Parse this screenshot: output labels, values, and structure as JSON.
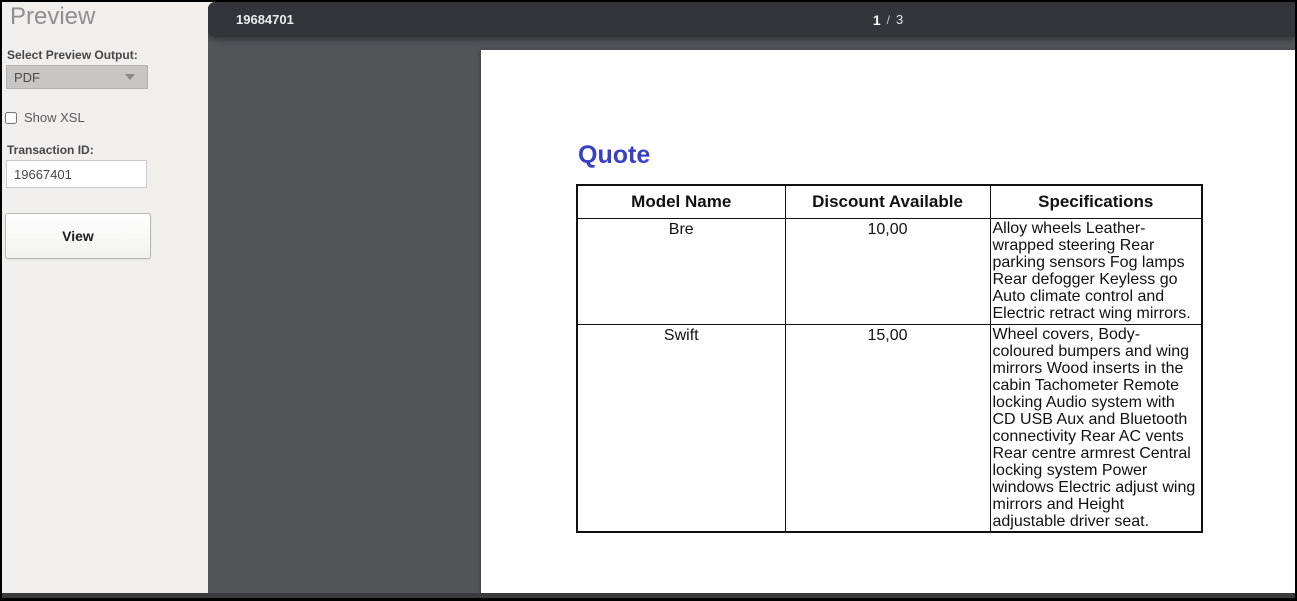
{
  "sidebar": {
    "title": "Preview",
    "output_label": "Select Preview Output:",
    "output_dropdown": {
      "value": "PDF"
    },
    "show_xsl": {
      "label": "Show XSL",
      "checked": false
    },
    "transaction_label": "Transaction ID:",
    "transaction_input": {
      "value": "19667401"
    },
    "view_button_label": "View"
  },
  "viewer": {
    "document_title": "19684701",
    "page_indicator": {
      "current": "1",
      "separator": "/",
      "total": "3"
    }
  },
  "pdf": {
    "heading": "Quote",
    "table": {
      "headers": [
        "Model Name",
        "Discount Available",
        "Specifications"
      ],
      "rows": [
        {
          "model": "Bre",
          "discount": "10,00",
          "specs": "Alloy wheels Leather-wrapped steering Rear parking sensors Fog lamps Rear defogger Keyless go Auto climate control and Electric retract wing mirrors."
        },
        {
          "model": "Swift",
          "discount": "15,00",
          "specs": "Wheel covers, Body-coloured bumpers and wing mirrors Wood inserts in the cabin Tachometer Remote locking Audio system with CD USB Aux and Bluetooth connectivity Rear AC vents Rear centre armrest Central locking system Power windows Electric adjust wing mirrors and Height adjustable driver seat."
        }
      ]
    }
  },
  "icons": {
    "dropdown_chevron": "chevron-down"
  },
  "colors": {
    "heading_blue": "#3a40c6",
    "toolbar_bg": "#32363b",
    "viewer_bg": "#525659",
    "sidebar_bg": "#f0efee",
    "dropdown_bg": "#c7c6c5",
    "table_border": "#111111"
  }
}
